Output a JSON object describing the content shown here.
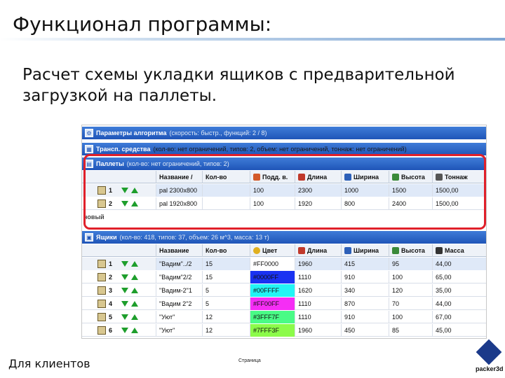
{
  "slide": {
    "title": "Функционал программы:",
    "subtitle": "Расчет схемы укладки ящиков с предварительной загрузкой на паллеты.",
    "footer_left": "Для клиентов",
    "footer_page": "Страница",
    "logo_text": "packer3d"
  },
  "colors": {
    "header_blue": "#2a64c8",
    "highlight_red": "#e0202a",
    "selected_row": "#dfe9f8"
  },
  "panels": {
    "algorithm": {
      "title": "Параметры алгоритма",
      "detail": "(скорость: быстр., функций: 2 / 8)"
    },
    "transport": {
      "title": "Трансп. средства",
      "detail": "(кол-во: нет ограничений, типов: 2, объем: нет ограничений, тоннаж: нет ограничений)"
    },
    "pallets": {
      "title": "Паллеты",
      "detail": "(кол-во: нет ограничений, типов: 2)"
    },
    "boxes": {
      "title": "Ящики",
      "detail": "(кол-во: 418, типов: 37, объем: 26 м^3, масса: 13 т)"
    }
  },
  "pallets_table": {
    "headers": [
      "Название /",
      "Кол-во",
      "Подд. в.",
      "Длина",
      "Ширина",
      "Высота",
      "Тоннаж"
    ],
    "rows": [
      {
        "num": "1",
        "name": "pal 2300x800",
        "qty": "",
        "base": "100",
        "length": "2300",
        "width": "1000",
        "height": "1500",
        "tonnage": "1500,00"
      },
      {
        "num": "2",
        "name": "pal 1920x800",
        "qty": "",
        "base": "100",
        "length": "1920",
        "width": "800",
        "height": "2400",
        "tonnage": "1500,00"
      }
    ],
    "new_row_label": "новый"
  },
  "boxes_table": {
    "headers": [
      "Название",
      "Кол-во",
      "Цвет",
      "Длина",
      "Ширина",
      "Высота",
      "Масса"
    ],
    "rows": [
      {
        "num": "1",
        "name": "\"Вадим\"../2",
        "qty": "15",
        "color": "#FF0000",
        "color_bg": "#ffffff",
        "length": "1960",
        "width": "415",
        "height": "95",
        "mass": "44,00"
      },
      {
        "num": "2",
        "name": "\"Вадим\"2/2",
        "qty": "15",
        "color": "#0000FF",
        "color_bg": "#1a32f2",
        "length": "1110",
        "width": "910",
        "height": "100",
        "mass": "65,00"
      },
      {
        "num": "3",
        "name": "\"Вадим-2\"1",
        "qty": "5",
        "color": "#00FFFF",
        "color_bg": "#22f5f5",
        "length": "1620",
        "width": "340",
        "height": "120",
        "mass": "35,00"
      },
      {
        "num": "4",
        "name": "\"Вадим 2\"2",
        "qty": "5",
        "color": "#FF00FF",
        "color_bg": "#f52ef5",
        "length": "1110",
        "width": "870",
        "height": "70",
        "mass": "44,00"
      },
      {
        "num": "5",
        "name": "\"Уют\"",
        "qty": "12",
        "color": "#3FFF7F",
        "color_bg": "#4afb86",
        "length": "1110",
        "width": "910",
        "height": "100",
        "mass": "67,00"
      },
      {
        "num": "6",
        "name": "\"Уют\"",
        "qty": "12",
        "color": "#7FFF3F",
        "color_bg": "#8cfb4a",
        "length": "1960",
        "width": "450",
        "height": "85",
        "mass": "45,00"
      }
    ]
  }
}
